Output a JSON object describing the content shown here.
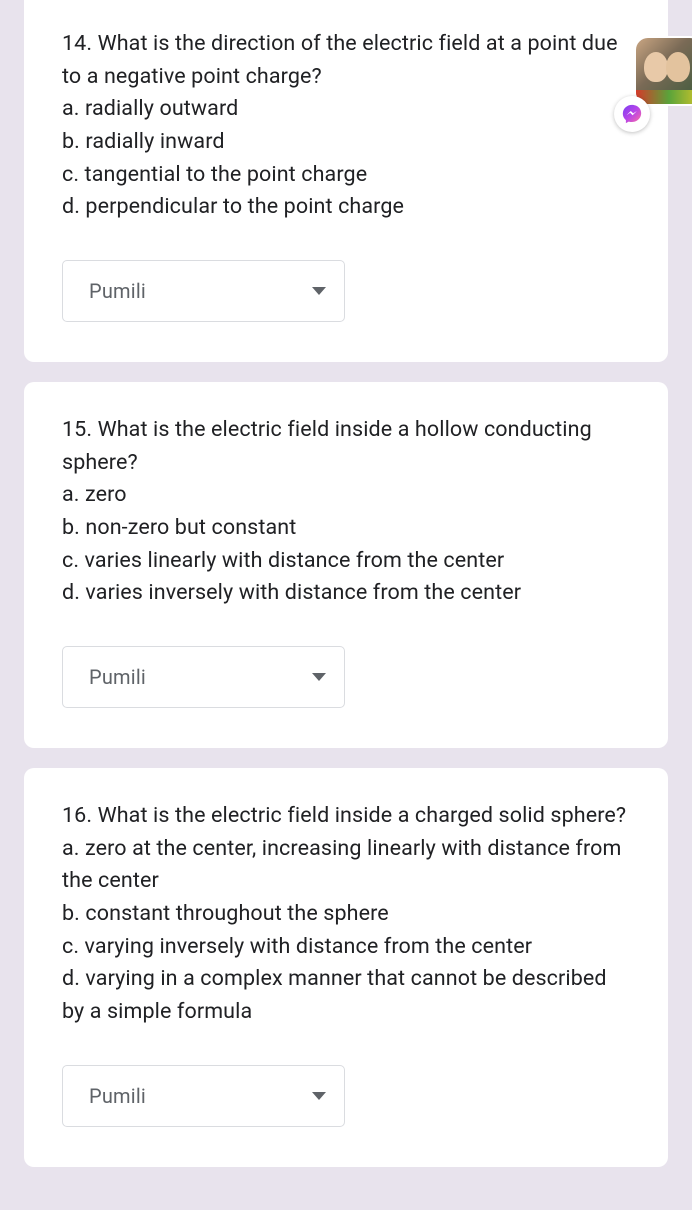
{
  "questions": [
    {
      "text": "14. What is the direction of the electric field at a point due to a negative point charge?\na. radially outward\nb. radially inward\nc. tangential to the point charge\nd. perpendicular to the point charge",
      "dropdown_label": "Pumili"
    },
    {
      "text": "15. What is the electric field inside a hollow conducting sphere?\na. zero\nb. non-zero but constant\nc. varies linearly with distance from the center\nd. varies inversely with distance from the center",
      "dropdown_label": "Pumili"
    },
    {
      "text": "16. What is the electric field inside a charged solid sphere?\na. zero at the center, increasing linearly with distance from the center\nb. constant throughout the sphere\nc. varying inversely with distance from the center\nd. varying in a complex manner that cannot be described by a simple formula",
      "dropdown_label": "Pumili"
    }
  ]
}
